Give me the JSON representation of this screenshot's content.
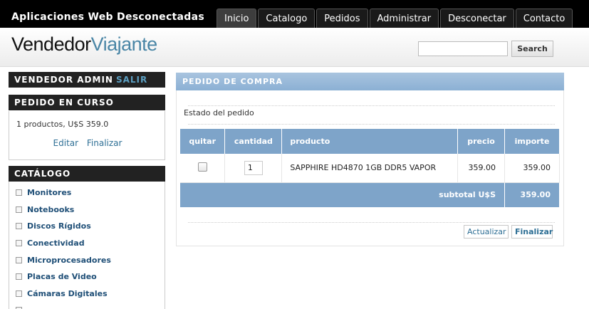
{
  "app": {
    "title": "Aplicaciones Web Desconectadas"
  },
  "nav": [
    "Inicio",
    "Catalogo",
    "Pedidos",
    "Administrar",
    "Desconectar",
    "Contacto"
  ],
  "logo": {
    "part1": "Vendedor",
    "part2": "Viajante"
  },
  "search": {
    "button": "Search",
    "value": ""
  },
  "sidebar": {
    "user_label": "VENDEDOR ADMIN",
    "logout_label": "SALIR",
    "pedido_title": "PEDIDO EN CURSO",
    "pedido_summary": "1 productos, U$S 359.0",
    "edit_link": "Editar",
    "finish_link": "Finalizar",
    "catalog_title": "CATÁLOGO",
    "categories": [
      "Monitores",
      "Notebooks",
      "Discos Rígidos",
      "Conectividad",
      "Microprocesadores",
      "Placas de Video",
      "Cámaras Digitales"
    ]
  },
  "main": {
    "panel_title": "PEDIDO DE COMPRA",
    "estado_label": "Estado del pedido",
    "columns": [
      "quitar",
      "cantidad",
      "producto",
      "precio",
      "importe"
    ],
    "rows": [
      {
        "cantidad": "1",
        "producto": "SAPPHIRE HD4870 1GB DDR5 VAPOR",
        "precio": "359.00",
        "importe": "359.00",
        "quitar": false
      }
    ],
    "subtotal_label": "subtotal U$S",
    "subtotal_value": "359.00",
    "update_button": "Actualizar",
    "finish_button": "Finalizar"
  }
}
